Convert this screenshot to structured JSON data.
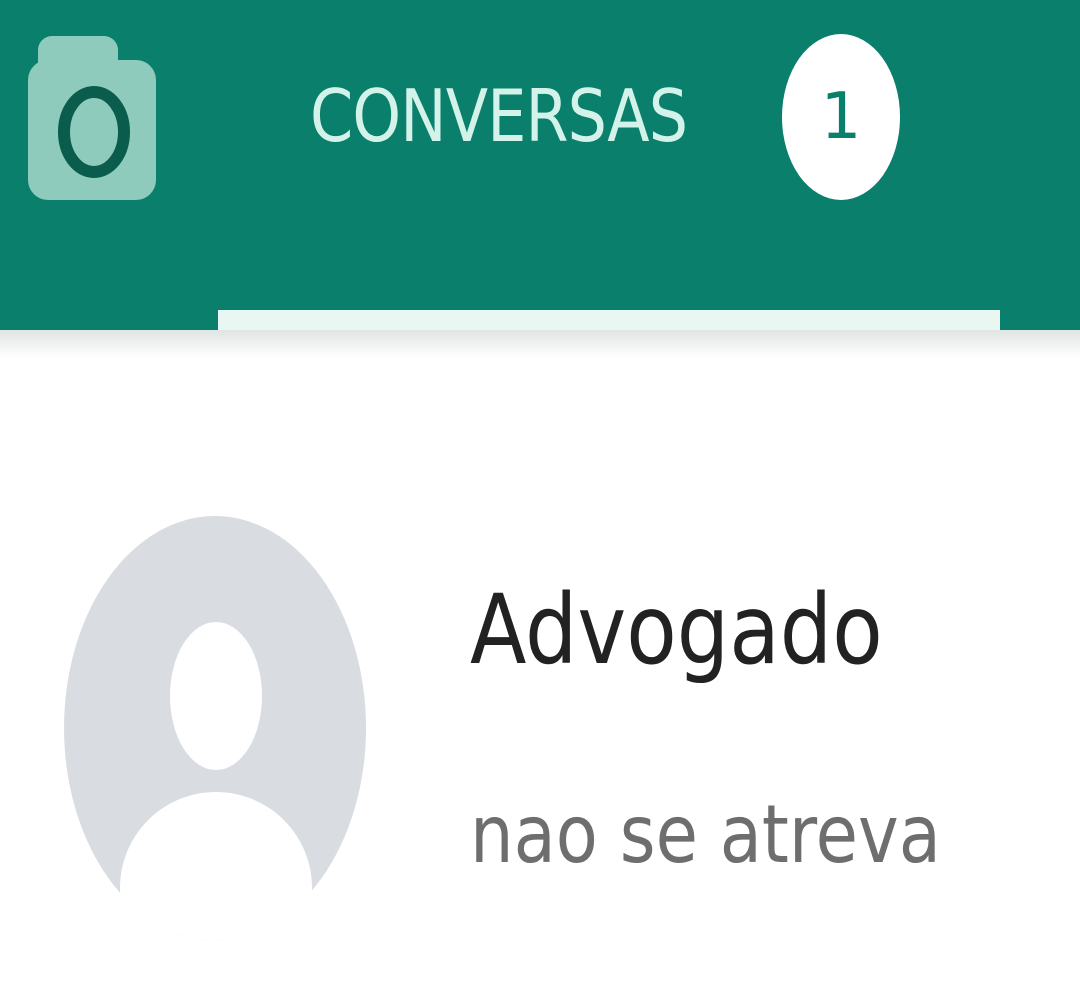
{
  "header": {
    "background_color": "#0a7f6b",
    "camera_tab": {
      "icon": "camera-icon"
    },
    "tabs": [
      {
        "label": "CONVERSAS",
        "unread_count": "1",
        "selected": true
      }
    ]
  },
  "chats": [
    {
      "name": "Advogado",
      "last_message": "nao se atreva",
      "avatar_icon": "default-avatar-icon"
    }
  ]
}
